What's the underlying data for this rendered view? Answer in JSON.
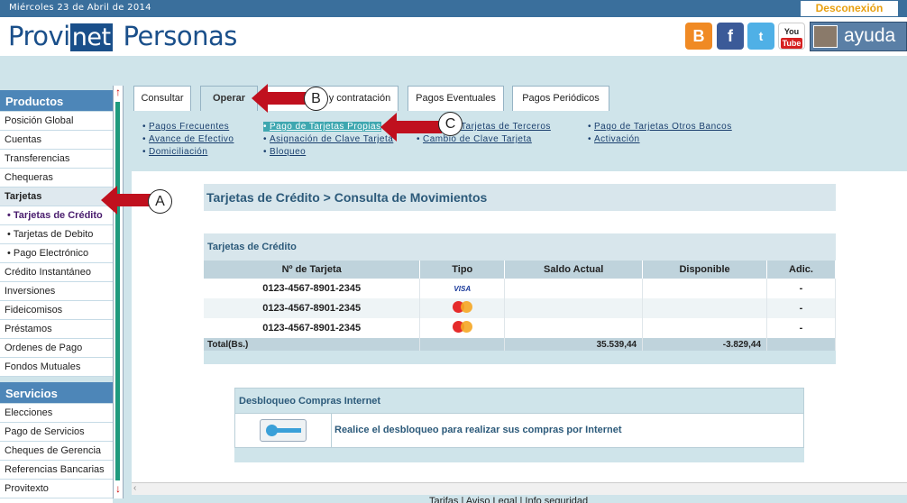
{
  "top_bar": {
    "date": "Miércoles 23 de Abril de 2014",
    "logout_label": "Desconexión"
  },
  "header": {
    "logo_prov": "Provi",
    "logo_net": "net",
    "logo_personas": "Personas",
    "help_label": "ayuda",
    "social": [
      "blogger-icon",
      "facebook-icon",
      "twitter-icon",
      "youtube-icon"
    ],
    "youtube_label": "You",
    "youtube_tube": "Tube"
  },
  "sidebar": {
    "products_header": "Productos",
    "products": [
      {
        "label": "Posición Global"
      },
      {
        "label": "Cuentas"
      },
      {
        "label": "Transferencias"
      },
      {
        "label": "Chequeras"
      },
      {
        "label": "Tarjetas"
      }
    ],
    "card_sub": [
      {
        "label": "• Tarjetas de Crédito"
      },
      {
        "label": "• Tarjetas de Debito"
      },
      {
        "label": "• Pago Electrónico"
      }
    ],
    "products_more": [
      {
        "label": "Crédito Instantáneo"
      },
      {
        "label": "Inversiones"
      },
      {
        "label": "Fideicomisos"
      },
      {
        "label": "Préstamos"
      },
      {
        "label": "Ordenes de Pago"
      },
      {
        "label": "Fondos Mutuales"
      }
    ],
    "services_header": "Servicios",
    "services": [
      {
        "label": "Elecciones"
      },
      {
        "label": "Pago de Servicios"
      },
      {
        "label": "Cheques de Gerencia"
      },
      {
        "label": "Referencias Bancarias"
      },
      {
        "label": "Provitexto"
      }
    ]
  },
  "tabs": [
    {
      "label": "Consultar"
    },
    {
      "label": "Operar"
    },
    {
      "label": "y contratación"
    },
    {
      "label": "Pagos Eventuales"
    },
    {
      "label": "Pagos Periódicos"
    }
  ],
  "subnav": {
    "col1": [
      "Pagos Frecuentes",
      "Avance de Efectivo",
      "Domiciliación"
    ],
    "col2": [
      "Pago de Tarjetas Propias",
      "Asignación de Clave Tarjeta",
      "Bloqueo"
    ],
    "col3": [
      "Tarjetas de Terceros",
      "Cambio de Clave Tarjeta"
    ],
    "col4": [
      "Pago de Tarjetas Otros Bancos",
      "Activación"
    ]
  },
  "page_title": "Tarjetas de Crédito > Consulta de Movimientos",
  "cards_panel": {
    "title": "Tarjetas de Crédito",
    "headers": [
      "Nº de Tarjeta",
      "Tipo",
      "Saldo Actual",
      "Disponible",
      "Adic."
    ],
    "rows": [
      {
        "number": "0123-4567-8901-2345",
        "type": "VISA",
        "saldo": "",
        "disponible": "",
        "adic": "-"
      },
      {
        "number": "0123-4567-8901-2345",
        "type": "MasterCard",
        "saldo": "",
        "disponible": "",
        "adic": "-"
      },
      {
        "number": "0123-4567-8901-2345",
        "type": "MasterCard",
        "saldo": "",
        "disponible": "",
        "adic": "-"
      }
    ],
    "total_label": "Total(Bs.)",
    "total_saldo": "35.539,44",
    "total_disponible": "-3.829,44"
  },
  "unblock_panel": {
    "title": "Desbloqueo Compras Internet",
    "text": "Realice el desbloqueo para realizar sus compras por Internet"
  },
  "footer": "Tarifas | Aviso Legal | Info seguridad",
  "annotations": {
    "a": "A",
    "b": "B",
    "c": "C"
  },
  "colors": {
    "accent": "#4d86b8",
    "arrow": "#c0101e",
    "panel": "#cfe4ea"
  }
}
